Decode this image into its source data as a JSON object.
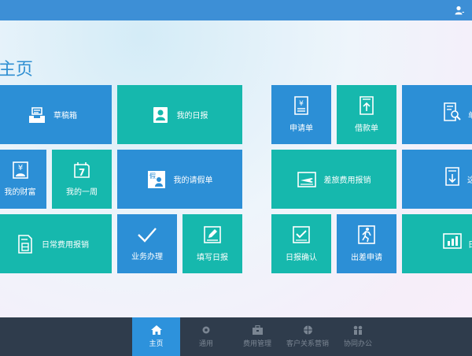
{
  "page_title": "主页",
  "tiles": {
    "drafts": "草稿箱",
    "my_daily_report": "我的日报",
    "my_wealth": "我的财富",
    "my_week": "我的一周",
    "my_leave_request": "我的请假单",
    "daily_expense_reimbursement": "日常费用报销",
    "business_handling": "业务办理",
    "fill_daily_report": "填写日报",
    "application_form": "申请单",
    "loan_form": "借款单",
    "partial_right_top": "单",
    "travel_expense_reimbursement": "差旅费用报销",
    "partial_right_mid": "这",
    "daily_report_confirm": "日报确认",
    "business_trip_application": "出差申请",
    "partial_right_bottom": "日"
  },
  "tabs": [
    "主页",
    "通用",
    "费用管理",
    "客户关系营销",
    "协同办公"
  ],
  "active_tab": "主页",
  "colors": {
    "topbar": "#3d8fd6",
    "tile_blue": "#2c8fd6",
    "tile_teal": "#16b8ad",
    "tabbar": "#2f3c4c",
    "tab_active": "#2d92dc"
  }
}
